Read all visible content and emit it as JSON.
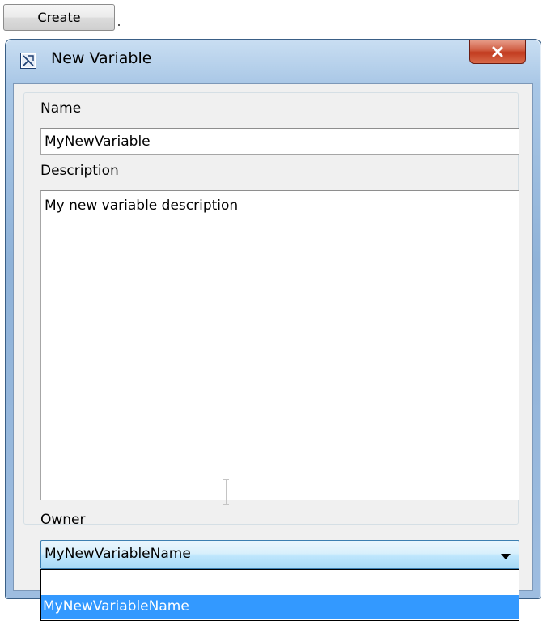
{
  "toolbar": {
    "create_label": "Create"
  },
  "window": {
    "title": "New Variable",
    "close_glyph": "x"
  },
  "form": {
    "name_label": "Name",
    "name_value": "MyNewVariable",
    "description_label": "Description",
    "description_value": "My new variable description",
    "owner_label": "Owner",
    "owner_selected": "MyNewVariableName",
    "owner_options": [
      "",
      "MyNewVariableName"
    ]
  },
  "icons": {
    "title": "diagram-icon",
    "close": "close-icon",
    "dropdown": "chevron-down-icon"
  },
  "colors": {
    "selection": "#3399ff",
    "close_button": "#c23b1f",
    "frame": "#9ebde0"
  }
}
